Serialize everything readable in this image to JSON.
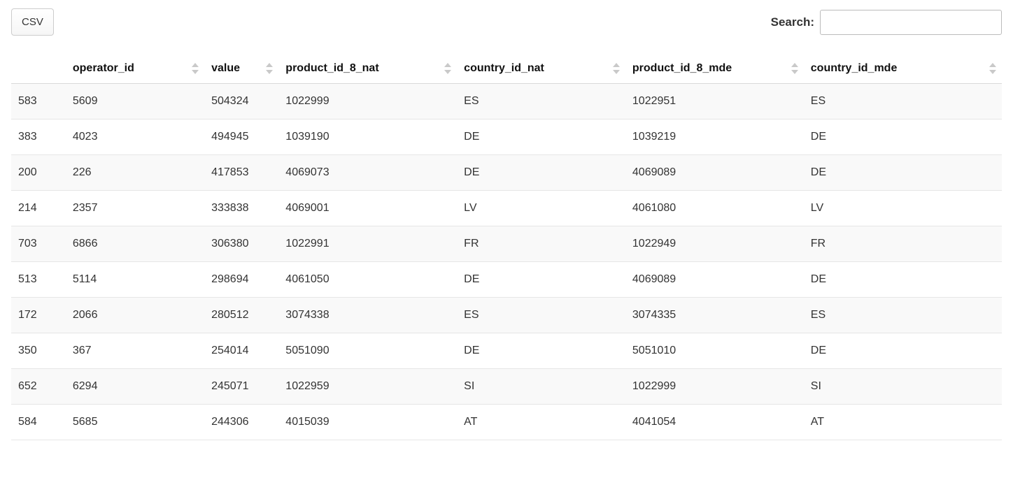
{
  "toolbar": {
    "csv_label": "CSV",
    "search_label": "Search:",
    "search_value": ""
  },
  "table": {
    "columns": [
      {
        "key": "rownum",
        "label": "",
        "sortable": false
      },
      {
        "key": "operator_id",
        "label": "operator_id",
        "sortable": true
      },
      {
        "key": "value",
        "label": "value",
        "sortable": true
      },
      {
        "key": "product_id_8_nat",
        "label": "product_id_8_nat",
        "sortable": true
      },
      {
        "key": "country_id_nat",
        "label": "country_id_nat",
        "sortable": true
      },
      {
        "key": "product_id_8_mde",
        "label": "product_id_8_mde",
        "sortable": true
      },
      {
        "key": "country_id_mde",
        "label": "country_id_mde",
        "sortable": true
      }
    ],
    "rows": [
      {
        "rownum": "583",
        "operator_id": "5609",
        "value": "504324",
        "product_id_8_nat": "1022999",
        "country_id_nat": "ES",
        "product_id_8_mde": "1022951",
        "country_id_mde": "ES"
      },
      {
        "rownum": "383",
        "operator_id": "4023",
        "value": "494945",
        "product_id_8_nat": "1039190",
        "country_id_nat": "DE",
        "product_id_8_mde": "1039219",
        "country_id_mde": "DE"
      },
      {
        "rownum": "200",
        "operator_id": "226",
        "value": "417853",
        "product_id_8_nat": "4069073",
        "country_id_nat": "DE",
        "product_id_8_mde": "4069089",
        "country_id_mde": "DE"
      },
      {
        "rownum": "214",
        "operator_id": "2357",
        "value": "333838",
        "product_id_8_nat": "4069001",
        "country_id_nat": "LV",
        "product_id_8_mde": "4061080",
        "country_id_mde": "LV"
      },
      {
        "rownum": "703",
        "operator_id": "6866",
        "value": "306380",
        "product_id_8_nat": "1022991",
        "country_id_nat": "FR",
        "product_id_8_mde": "1022949",
        "country_id_mde": "FR"
      },
      {
        "rownum": "513",
        "operator_id": "5114",
        "value": "298694",
        "product_id_8_nat": "4061050",
        "country_id_nat": "DE",
        "product_id_8_mde": "4069089",
        "country_id_mde": "DE"
      },
      {
        "rownum": "172",
        "operator_id": "2066",
        "value": "280512",
        "product_id_8_nat": "3074338",
        "country_id_nat": "ES",
        "product_id_8_mde": "3074335",
        "country_id_mde": "ES"
      },
      {
        "rownum": "350",
        "operator_id": "367",
        "value": "254014",
        "product_id_8_nat": "5051090",
        "country_id_nat": "DE",
        "product_id_8_mde": "5051010",
        "country_id_mde": "DE"
      },
      {
        "rownum": "652",
        "operator_id": "6294",
        "value": "245071",
        "product_id_8_nat": "1022959",
        "country_id_nat": "SI",
        "product_id_8_mde": "1022999",
        "country_id_mde": "SI"
      },
      {
        "rownum": "584",
        "operator_id": "5685",
        "value": "244306",
        "product_id_8_nat": "4015039",
        "country_id_nat": "AT",
        "product_id_8_mde": "4041054",
        "country_id_mde": "AT"
      }
    ]
  }
}
